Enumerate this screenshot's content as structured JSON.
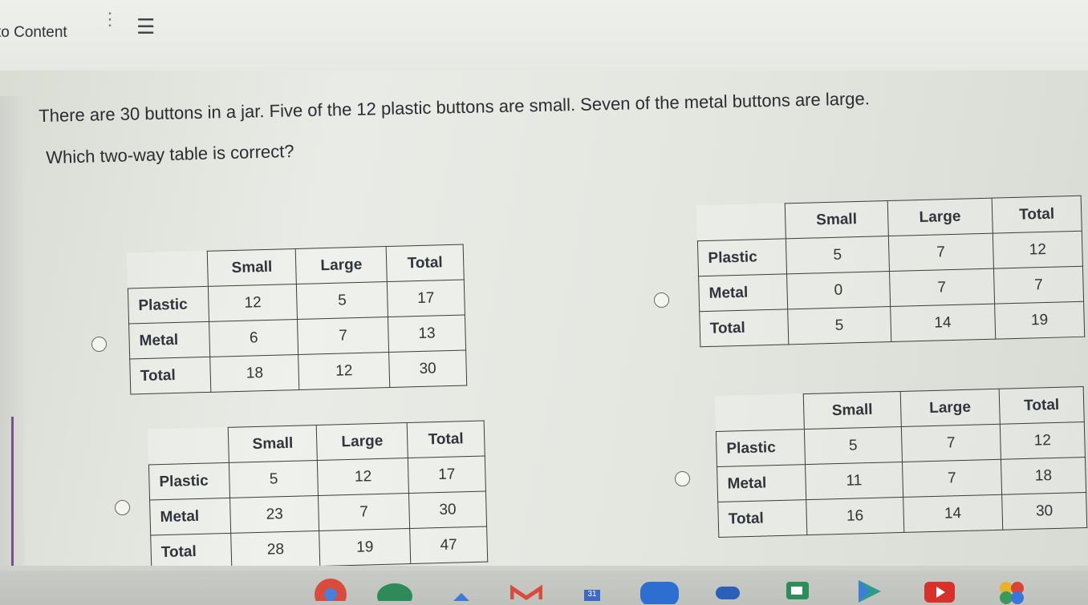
{
  "topbar": {
    "skip_link": "to Content",
    "menu_icon": "hamburger-icon"
  },
  "question": {
    "text": "There are 30 buttons in a jar. Five of the 12 plastic buttons are small. Seven of the metal buttons are large.",
    "prompt": "Which two-way table is correct?"
  },
  "options": [
    {
      "headers": [
        "Small",
        "Large",
        "Total"
      ],
      "rows": [
        {
          "label": "Plastic",
          "values": [
            "12",
            "5",
            "17"
          ]
        },
        {
          "label": "Metal",
          "values": [
            "6",
            "7",
            "13"
          ]
        },
        {
          "label": "Total",
          "values": [
            "18",
            "12",
            "30"
          ]
        }
      ]
    },
    {
      "headers": [
        "Small",
        "Large",
        "Total"
      ],
      "rows": [
        {
          "label": "Plastic",
          "values": [
            "5",
            "7",
            "12"
          ]
        },
        {
          "label": "Metal",
          "values": [
            "0",
            "7",
            "7"
          ]
        },
        {
          "label": "Total",
          "values": [
            "5",
            "14",
            "19"
          ]
        }
      ]
    },
    {
      "headers": [
        "Small",
        "Large",
        "Total"
      ],
      "rows": [
        {
          "label": "Plastic",
          "values": [
            "5",
            "12",
            "17"
          ]
        },
        {
          "label": "Metal",
          "values": [
            "23",
            "7",
            "30"
          ]
        },
        {
          "label": "Total",
          "values": [
            "28",
            "19",
            "47"
          ]
        }
      ]
    },
    {
      "headers": [
        "Small",
        "Large",
        "Total"
      ],
      "rows": [
        {
          "label": "Plastic",
          "values": [
            "5",
            "7",
            "12"
          ]
        },
        {
          "label": "Metal",
          "values": [
            "11",
            "7",
            "18"
          ]
        },
        {
          "label": "Total",
          "values": [
            "16",
            "14",
            "30"
          ]
        }
      ]
    }
  ],
  "taskbar": {
    "calendar_day": "31",
    "icons": [
      "chrome-icon",
      "classroom-icon",
      "drive-icon",
      "gmail-icon",
      "calendar-icon",
      "files-icon",
      "meet-icon",
      "chat-icon",
      "play-store-icon",
      "youtube-icon",
      "photos-icon"
    ]
  },
  "colors": {
    "accent_purple": "#7a4f8a",
    "table_border": "#3c3c3c"
  }
}
